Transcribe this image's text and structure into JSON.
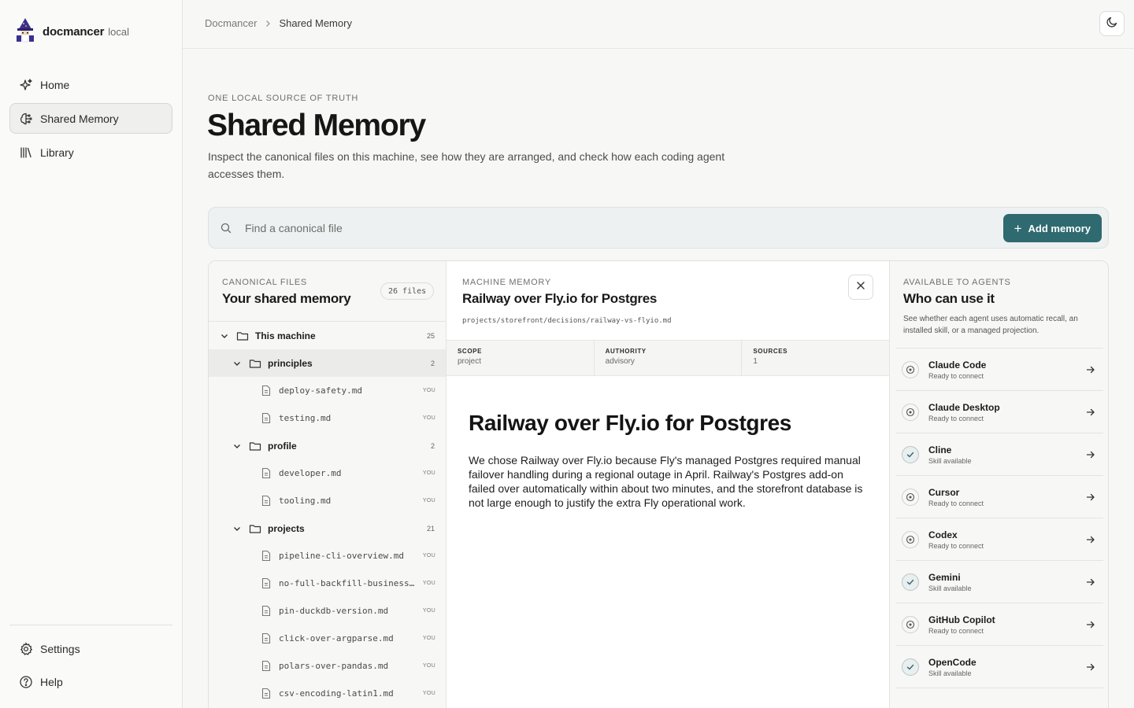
{
  "app": {
    "name": "docmancer",
    "tag": "local"
  },
  "sidebar": {
    "items": [
      {
        "label": "Home",
        "icon": "sparkle-icon"
      },
      {
        "label": "Shared Memory",
        "icon": "brain-icon"
      },
      {
        "label": "Library",
        "icon": "library-icon"
      }
    ],
    "bottom": [
      {
        "label": "Settings",
        "icon": "gear-icon"
      },
      {
        "label": "Help",
        "icon": "help-icon"
      }
    ]
  },
  "breadcrumb": {
    "root": "Docmancer",
    "current": "Shared Memory"
  },
  "hero": {
    "eyebrow": "ONE LOCAL SOURCE OF TRUTH",
    "title": "Shared Memory",
    "description": "Inspect the canonical files on this machine, see how they are arranged, and check how each coding agent accesses them."
  },
  "search": {
    "placeholder": "Find a canonical file",
    "add_label": "Add memory"
  },
  "files": {
    "eyebrow": "CANONICAL FILES",
    "title": "Your shared memory",
    "count": "26 files",
    "tree": {
      "root": {
        "label": "This machine",
        "count": "25"
      },
      "folders": [
        {
          "label": "principles",
          "count": "2",
          "files": [
            {
              "name": "deploy-safety.md",
              "owner": "YOU"
            },
            {
              "name": "testing.md",
              "owner": "YOU"
            }
          ]
        },
        {
          "label": "profile",
          "count": "2",
          "files": [
            {
              "name": "developer.md",
              "owner": "YOU"
            },
            {
              "name": "tooling.md",
              "owner": "YOU"
            }
          ]
        },
        {
          "label": "projects",
          "count": "21",
          "files": [
            {
              "name": "pipeline-cli-overview.md",
              "owner": "YOU"
            },
            {
              "name": "no-full-backfill-business-h…",
              "owner": "YOU"
            },
            {
              "name": "pin-duckdb-version.md",
              "owner": "YOU"
            },
            {
              "name": "click-over-argparse.md",
              "owner": "YOU"
            },
            {
              "name": "polars-over-pandas.md",
              "owner": "YOU"
            },
            {
              "name": "csv-encoding-latin1.md",
              "owner": "YOU"
            }
          ]
        }
      ]
    }
  },
  "detail": {
    "eyebrow": "MACHINE MEMORY",
    "title": "Railway over Fly.io for Postgres",
    "path": "projects/storefront/decisions/railway-vs-flyio.md",
    "meta": [
      {
        "key": "SCOPE",
        "value": "project"
      },
      {
        "key": "AUTHORITY",
        "value": "advisory"
      },
      {
        "key": "SOURCES",
        "value": "1"
      }
    ],
    "doc_title": "Railway over Fly.io for Postgres",
    "doc_body": "We chose Railway over Fly.io because Fly's managed Postgres required manual failover handling during a regional outage in April. Railway's Postgres add-on failed over automatically within about two minutes, and the storefront database is not large enough to justify the extra Fly operational work."
  },
  "agents": {
    "eyebrow": "AVAILABLE TO AGENTS",
    "title": "Who can use it",
    "description": "See whether each agent uses automatic recall, an installed skill, or a managed projection.",
    "items": [
      {
        "name": "Claude Code",
        "status": "Ready to connect",
        "icon": "target-icon"
      },
      {
        "name": "Claude Desktop",
        "status": "Ready to connect",
        "icon": "target-icon"
      },
      {
        "name": "Cline",
        "status": "Skill available",
        "icon": "check-icon"
      },
      {
        "name": "Cursor",
        "status": "Ready to connect",
        "icon": "target-icon"
      },
      {
        "name": "Codex",
        "status": "Ready to connect",
        "icon": "target-icon"
      },
      {
        "name": "Gemini",
        "status": "Skill available",
        "icon": "check-icon"
      },
      {
        "name": "GitHub Copilot",
        "status": "Ready to connect",
        "icon": "target-icon"
      },
      {
        "name": "OpenCode",
        "status": "Skill available",
        "icon": "check-icon"
      }
    ]
  },
  "colors": {
    "accent": "#2f6a70",
    "background": "#f7f7f6",
    "selected_row": "#ebebea"
  }
}
